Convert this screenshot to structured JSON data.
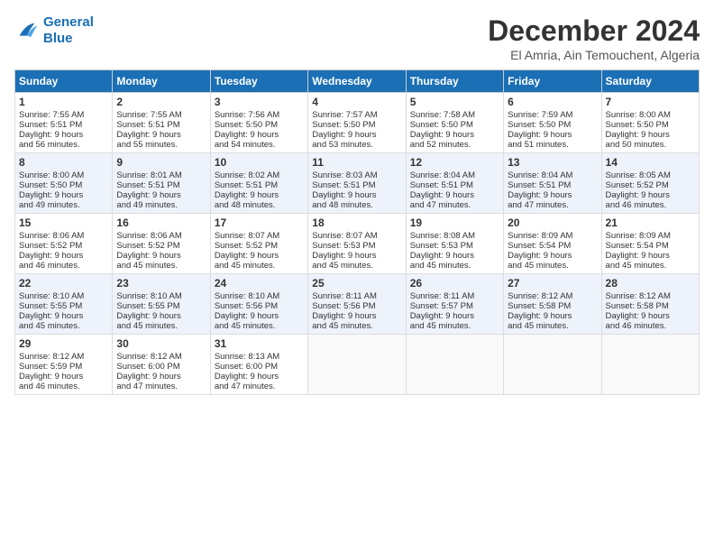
{
  "logo": {
    "line1": "General",
    "line2": "Blue"
  },
  "title": "December 2024",
  "subtitle": "El Amria, Ain Temouchent, Algeria",
  "headers": [
    "Sunday",
    "Monday",
    "Tuesday",
    "Wednesday",
    "Thursday",
    "Friday",
    "Saturday"
  ],
  "weeks": [
    [
      {
        "day": "1",
        "lines": [
          "Sunrise: 7:55 AM",
          "Sunset: 5:51 PM",
          "Daylight: 9 hours",
          "and 56 minutes."
        ]
      },
      {
        "day": "2",
        "lines": [
          "Sunrise: 7:55 AM",
          "Sunset: 5:51 PM",
          "Daylight: 9 hours",
          "and 55 minutes."
        ]
      },
      {
        "day": "3",
        "lines": [
          "Sunrise: 7:56 AM",
          "Sunset: 5:50 PM",
          "Daylight: 9 hours",
          "and 54 minutes."
        ]
      },
      {
        "day": "4",
        "lines": [
          "Sunrise: 7:57 AM",
          "Sunset: 5:50 PM",
          "Daylight: 9 hours",
          "and 53 minutes."
        ]
      },
      {
        "day": "5",
        "lines": [
          "Sunrise: 7:58 AM",
          "Sunset: 5:50 PM",
          "Daylight: 9 hours",
          "and 52 minutes."
        ]
      },
      {
        "day": "6",
        "lines": [
          "Sunrise: 7:59 AM",
          "Sunset: 5:50 PM",
          "Daylight: 9 hours",
          "and 51 minutes."
        ]
      },
      {
        "day": "7",
        "lines": [
          "Sunrise: 8:00 AM",
          "Sunset: 5:50 PM",
          "Daylight: 9 hours",
          "and 50 minutes."
        ]
      }
    ],
    [
      {
        "day": "8",
        "lines": [
          "Sunrise: 8:00 AM",
          "Sunset: 5:50 PM",
          "Daylight: 9 hours",
          "and 49 minutes."
        ]
      },
      {
        "day": "9",
        "lines": [
          "Sunrise: 8:01 AM",
          "Sunset: 5:51 PM",
          "Daylight: 9 hours",
          "and 49 minutes."
        ]
      },
      {
        "day": "10",
        "lines": [
          "Sunrise: 8:02 AM",
          "Sunset: 5:51 PM",
          "Daylight: 9 hours",
          "and 48 minutes."
        ]
      },
      {
        "day": "11",
        "lines": [
          "Sunrise: 8:03 AM",
          "Sunset: 5:51 PM",
          "Daylight: 9 hours",
          "and 48 minutes."
        ]
      },
      {
        "day": "12",
        "lines": [
          "Sunrise: 8:04 AM",
          "Sunset: 5:51 PM",
          "Daylight: 9 hours",
          "and 47 minutes."
        ]
      },
      {
        "day": "13",
        "lines": [
          "Sunrise: 8:04 AM",
          "Sunset: 5:51 PM",
          "Daylight: 9 hours",
          "and 47 minutes."
        ]
      },
      {
        "day": "14",
        "lines": [
          "Sunrise: 8:05 AM",
          "Sunset: 5:52 PM",
          "Daylight: 9 hours",
          "and 46 minutes."
        ]
      }
    ],
    [
      {
        "day": "15",
        "lines": [
          "Sunrise: 8:06 AM",
          "Sunset: 5:52 PM",
          "Daylight: 9 hours",
          "and 46 minutes."
        ]
      },
      {
        "day": "16",
        "lines": [
          "Sunrise: 8:06 AM",
          "Sunset: 5:52 PM",
          "Daylight: 9 hours",
          "and 45 minutes."
        ]
      },
      {
        "day": "17",
        "lines": [
          "Sunrise: 8:07 AM",
          "Sunset: 5:52 PM",
          "Daylight: 9 hours",
          "and 45 minutes."
        ]
      },
      {
        "day": "18",
        "lines": [
          "Sunrise: 8:07 AM",
          "Sunset: 5:53 PM",
          "Daylight: 9 hours",
          "and 45 minutes."
        ]
      },
      {
        "day": "19",
        "lines": [
          "Sunrise: 8:08 AM",
          "Sunset: 5:53 PM",
          "Daylight: 9 hours",
          "and 45 minutes."
        ]
      },
      {
        "day": "20",
        "lines": [
          "Sunrise: 8:09 AM",
          "Sunset: 5:54 PM",
          "Daylight: 9 hours",
          "and 45 minutes."
        ]
      },
      {
        "day": "21",
        "lines": [
          "Sunrise: 8:09 AM",
          "Sunset: 5:54 PM",
          "Daylight: 9 hours",
          "and 45 minutes."
        ]
      }
    ],
    [
      {
        "day": "22",
        "lines": [
          "Sunrise: 8:10 AM",
          "Sunset: 5:55 PM",
          "Daylight: 9 hours",
          "and 45 minutes."
        ]
      },
      {
        "day": "23",
        "lines": [
          "Sunrise: 8:10 AM",
          "Sunset: 5:55 PM",
          "Daylight: 9 hours",
          "and 45 minutes."
        ]
      },
      {
        "day": "24",
        "lines": [
          "Sunrise: 8:10 AM",
          "Sunset: 5:56 PM",
          "Daylight: 9 hours",
          "and 45 minutes."
        ]
      },
      {
        "day": "25",
        "lines": [
          "Sunrise: 8:11 AM",
          "Sunset: 5:56 PM",
          "Daylight: 9 hours",
          "and 45 minutes."
        ]
      },
      {
        "day": "26",
        "lines": [
          "Sunrise: 8:11 AM",
          "Sunset: 5:57 PM",
          "Daylight: 9 hours",
          "and 45 minutes."
        ]
      },
      {
        "day": "27",
        "lines": [
          "Sunrise: 8:12 AM",
          "Sunset: 5:58 PM",
          "Daylight: 9 hours",
          "and 45 minutes."
        ]
      },
      {
        "day": "28",
        "lines": [
          "Sunrise: 8:12 AM",
          "Sunset: 5:58 PM",
          "Daylight: 9 hours",
          "and 46 minutes."
        ]
      }
    ],
    [
      {
        "day": "29",
        "lines": [
          "Sunrise: 8:12 AM",
          "Sunset: 5:59 PM",
          "Daylight: 9 hours",
          "and 46 minutes."
        ]
      },
      {
        "day": "30",
        "lines": [
          "Sunrise: 8:12 AM",
          "Sunset: 6:00 PM",
          "Daylight: 9 hours",
          "and 47 minutes."
        ]
      },
      {
        "day": "31",
        "lines": [
          "Sunrise: 8:13 AM",
          "Sunset: 6:00 PM",
          "Daylight: 9 hours",
          "and 47 minutes."
        ]
      },
      null,
      null,
      null,
      null
    ]
  ]
}
